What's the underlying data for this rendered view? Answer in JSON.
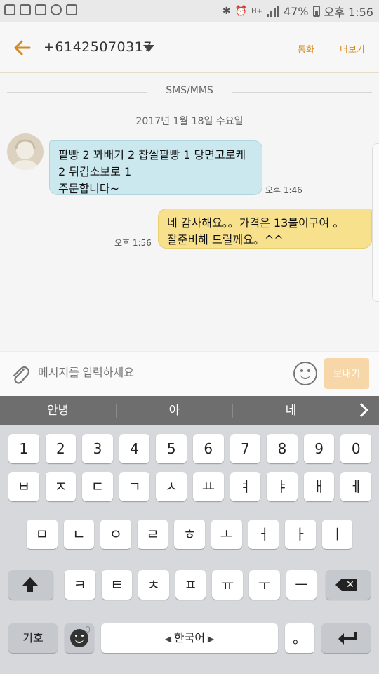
{
  "status_bar": {
    "battery": "47%",
    "time": "오후 1:56",
    "network": "H+"
  },
  "header": {
    "contact": "+61425070317",
    "call": "통화",
    "more": "더보기"
  },
  "thread": {
    "channel": "SMS/MMS",
    "date": "2017년 1월 18일 수요일",
    "messages": [
      {
        "direction": "incoming",
        "line1": "팥빵 2 꽈배기 2 찹쌀팥빵 1 당면고로케",
        "line2": "2 튀김소보로 1",
        "line3": "주문합니다~",
        "time": "오후 1:46"
      },
      {
        "direction": "outgoing",
        "line1": "네 감사해요。。가격은 13불이구여 。",
        "line2": "잘준비해 드릴께요。^^",
        "time": "오후 1:56"
      }
    ]
  },
  "composer": {
    "placeholder": "메시지를 입력하세요",
    "send": "보내기"
  },
  "suggestions": [
    "안녕",
    "아",
    "네"
  ],
  "keyboard": {
    "row_numbers": [
      "1",
      "2",
      "3",
      "4",
      "5",
      "6",
      "7",
      "8",
      "9",
      "0"
    ],
    "row1": [
      "ㅂ",
      "ㅈ",
      "ㄷ",
      "ㄱ",
      "ㅅ",
      "ㅛ",
      "ㅕ",
      "ㅑ",
      "ㅐ",
      "ㅔ"
    ],
    "row2": [
      "ㅁ",
      "ㄴ",
      "ㅇ",
      "ㄹ",
      "ㅎ",
      "ㅗ",
      "ㅓ",
      "ㅏ",
      "ㅣ"
    ],
    "row3": [
      "ㅋ",
      "ㅌ",
      "ㅊ",
      "ㅍ",
      "ㅠ",
      "ㅜ",
      "ㅡ"
    ],
    "symbols": "기호",
    "space": "한국어",
    "period": "。"
  },
  "colors": {
    "accent": "#d68a1e",
    "incoming_bubble": "#cbe8ef",
    "outgoing_bubble": "#f7e18c",
    "send_button": "#f7d7a8"
  },
  "icons": [
    "gallery-icon",
    "map-icon",
    "location-icon",
    "sync-icon",
    "briefcase-icon",
    "bluetooth-icon",
    "alarm-icon",
    "signal-icon",
    "battery-icon",
    "back-arrow-icon",
    "dropdown-caret-icon",
    "attach-icon",
    "emoji-icon",
    "shift-icon",
    "backspace-icon",
    "enter-icon",
    "mic-icon"
  ]
}
